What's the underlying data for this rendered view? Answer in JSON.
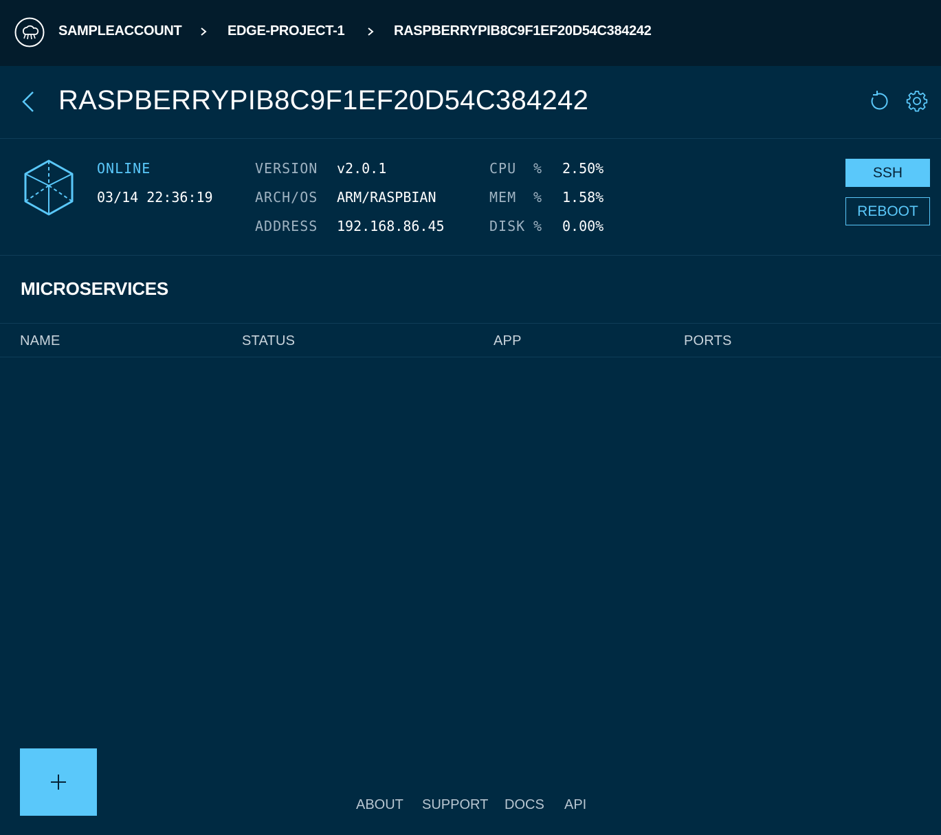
{
  "breadcrumb": {
    "items": [
      "SAMPLEACCOUNT",
      "EDGE-PROJECT-1",
      "RASPBERRYPIB8C9F1EF20D54C384242"
    ],
    "logo_icon": "cloud-network-icon",
    "separator_icon": "chevron-right-icon"
  },
  "header": {
    "title": "RASPBERRYPIB8C9F1EF20D54C384242",
    "back_icon": "chevron-left-icon",
    "actions": [
      "refresh-icon",
      "gear-icon"
    ]
  },
  "device": {
    "icon": "cube-icon",
    "status": "ONLINE",
    "timestamp": "03/14 22:36:19",
    "details": [
      {
        "label": "VERSION",
        "value": "v2.0.1"
      },
      {
        "label": "ARCH/OS",
        "value": "ARM/RASPBIAN"
      },
      {
        "label": "ADDRESS",
        "value": "192.168.86.45"
      }
    ],
    "metrics": [
      {
        "label": "CPU",
        "unit": "%",
        "value": "2.50%"
      },
      {
        "label": "MEM",
        "unit": "%",
        "value": "1.58%"
      },
      {
        "label": "DISK",
        "unit": "%",
        "value": "0.00%"
      }
    ],
    "buttons": {
      "ssh": "SSH",
      "reboot": "REBOOT"
    }
  },
  "microservices": {
    "title": "MICROSERVICES",
    "columns": [
      "NAME",
      "STATUS",
      "APP",
      "PORTS"
    ],
    "rows": []
  },
  "fab": {
    "icon": "plus-icon"
  },
  "footer": {
    "links": [
      "ABOUT",
      "SUPPORT",
      "DOCS",
      "API"
    ]
  },
  "colors": {
    "accent": "#5ac8fa",
    "background": "#002a42",
    "topbar": "#031c2c"
  }
}
